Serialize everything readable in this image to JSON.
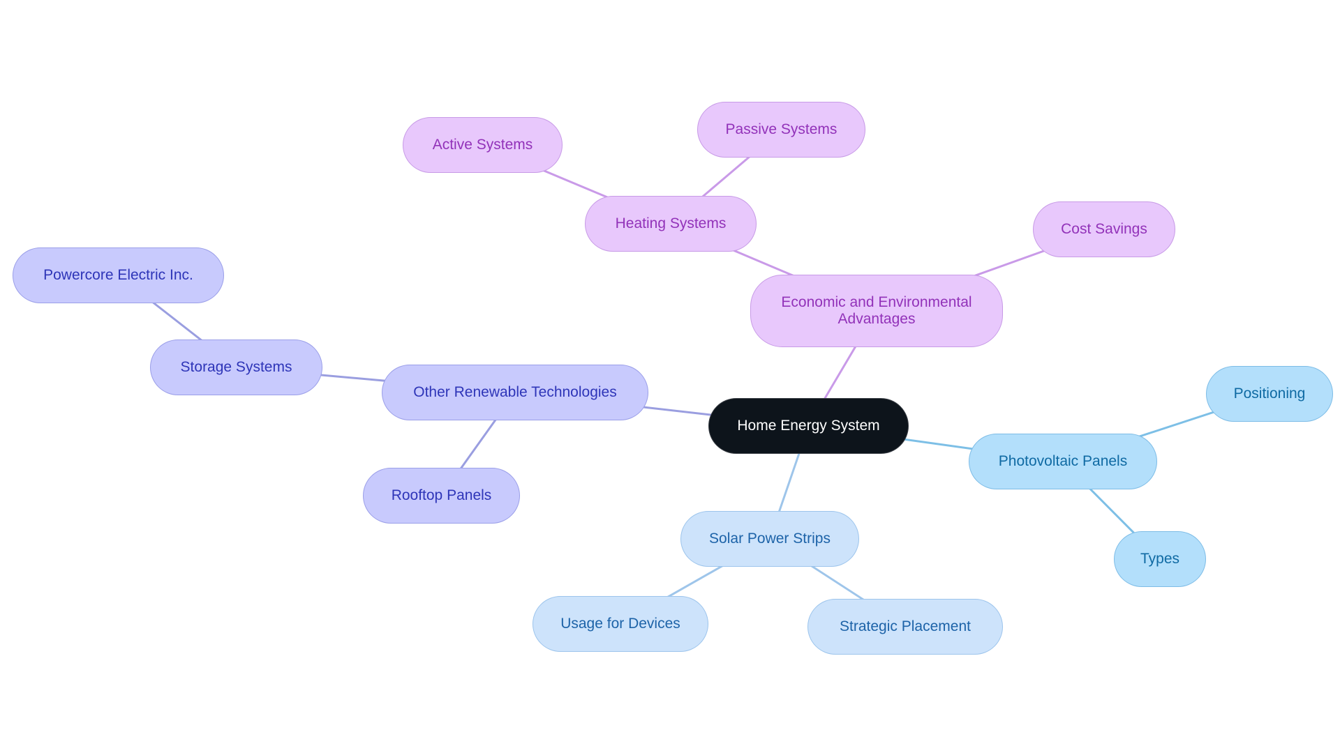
{
  "diagram": {
    "type": "mindmap",
    "root": {
      "id": "root",
      "label": "Home Energy System"
    },
    "branch_colors": {
      "root": {
        "fill": "#0d141b",
        "text": "#ffffff"
      },
      "purple": {
        "fill": "#e8c8fc",
        "border": "#c79ae6",
        "text": "#9232b9",
        "edge": "#c99ae8"
      },
      "indigo": {
        "fill": "#c8cafd",
        "border": "#9a9ee8",
        "text": "#2e35b8",
        "edge": "#9a9ee0"
      },
      "lightblue": {
        "fill": "#cde3fb",
        "border": "#9cc4ec",
        "text": "#1d63a8",
        "edge": "#9ec5ea"
      },
      "skyblue": {
        "fill": "#b3dffb",
        "border": "#7dbce6",
        "text": "#0f6aa3",
        "edge": "#7dbfe6"
      }
    },
    "nodes": [
      {
        "id": "root",
        "label": "Home Energy System",
        "color": "root"
      },
      {
        "id": "econ",
        "label": "Economic and Environmental Advantages",
        "color": "purple",
        "parent": "root"
      },
      {
        "id": "heating",
        "label": "Heating Systems",
        "color": "purple",
        "parent": "econ"
      },
      {
        "id": "active",
        "label": "Active Systems",
        "color": "purple",
        "parent": "heating"
      },
      {
        "id": "passive",
        "label": "Passive Systems",
        "color": "purple",
        "parent": "heating"
      },
      {
        "id": "cost",
        "label": "Cost Savings",
        "color": "purple",
        "parent": "econ"
      },
      {
        "id": "other",
        "label": "Other Renewable Technologies",
        "color": "indigo",
        "parent": "root"
      },
      {
        "id": "storage",
        "label": "Storage Systems",
        "color": "indigo",
        "parent": "other"
      },
      {
        "id": "powercore",
        "label": "Powercore Electric Inc.",
        "color": "indigo",
        "parent": "storage"
      },
      {
        "id": "rooftop",
        "label": "Rooftop Panels",
        "color": "indigo",
        "parent": "other"
      },
      {
        "id": "strips",
        "label": "Solar Power Strips",
        "color": "lightblue",
        "parent": "root"
      },
      {
        "id": "usage",
        "label": "Usage for Devices",
        "color": "lightblue",
        "parent": "strips"
      },
      {
        "id": "placement",
        "label": "Strategic Placement",
        "color": "lightblue",
        "parent": "strips"
      },
      {
        "id": "pv",
        "label": "Photovoltaic Panels",
        "color": "skyblue",
        "parent": "root"
      },
      {
        "id": "positioning",
        "label": "Positioning",
        "color": "skyblue",
        "parent": "pv"
      },
      {
        "id": "types",
        "label": "Types",
        "color": "skyblue",
        "parent": "pv"
      }
    ]
  }
}
